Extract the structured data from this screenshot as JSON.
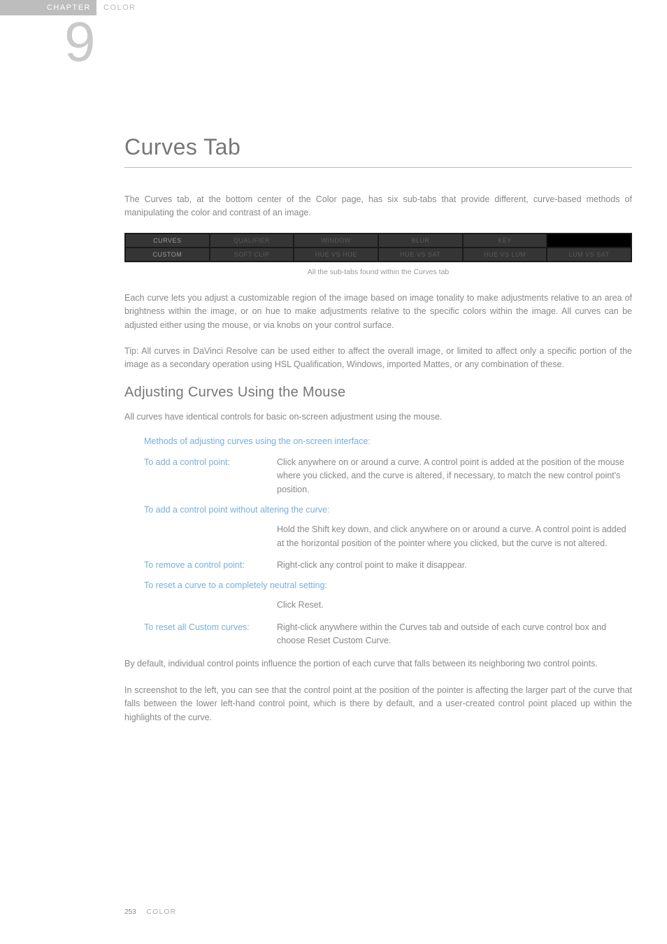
{
  "header": {
    "chapter_label": "CHAPTER",
    "section_label": "COLOR",
    "chapter_number": "9"
  },
  "title": "Curves Tab",
  "intro": "The Curves tab, at the bottom center of the Color page, has six sub-tabs that provide different, curve-based methods of manipulating the color and contrast of an image.",
  "tabs": {
    "row1": [
      "CURVES",
      "QUALIFIER",
      "WINDOW",
      "BLUR",
      "KEY",
      ""
    ],
    "row2": [
      "CUSTOM",
      "SOFT CLIP",
      "HUE VS HUE",
      "HUE VS SAT",
      "HUE VS LUM",
      "LUM VS SAT"
    ],
    "caption": "All the sub-tabs found within the Curves tab"
  },
  "para2": "Each curve lets you adjust a customizable region of the image based on image tonality to make adjustments relative to an area of brightness within the image, or on hue to make adjustments relative to the specific colors within the image. All curves can be adjusted either using the mouse, or via knobs on your control surface.",
  "para3": "Tip: All curves in DaVinci Resolve can be used either to affect the overall image, or limited to affect only a specific portion of the image as a secondary operation using HSL Qualification, Windows, imported Mattes, or any combination of these.",
  "h2": "Adjusting Curves Using the Mouse",
  "para4": "All curves have identical controls for basic on-screen adjustment using the mouse.",
  "methods": {
    "title": "Methods of adjusting curves using the on-screen interface:",
    "m1_term": "To add a control point:",
    "m1_desc": "Click anywhere on or around a curve. A control point is added at the position of the mouse where you clicked, and the curve is altered, if necessary, to match the new control point's position.",
    "m2_full": "To add a control point without altering the curve:",
    "m2_desc": "Hold the Shift key down, and click anywhere on or around a curve. A control point is added at the horizontal position of the pointer where you clicked, but the curve is not altered.",
    "m3_term": "To remove a control point:",
    "m3_desc": "Right-click any control point to make it disappear.",
    "m4_full": "To reset a curve to a completely neutral setting:",
    "m4_desc": "Click Reset.",
    "m5_term": "To reset all Custom curves:",
    "m5_desc": "Right-click anywhere within the Curves tab and outside of each curve control box and choose Reset Custom Curve."
  },
  "para5": "By default, individual control points influence the portion of each curve that falls between its neighboring two control points.",
  "para6": "In screenshot to the left, you can see that the control point at the position of the pointer is affecting the larger part of the curve that falls between the lower left-hand control point, which is there by default, and a user-created control point placed up within the highlights of the curve.",
  "footer": {
    "page": "253",
    "section": "COLOR"
  }
}
